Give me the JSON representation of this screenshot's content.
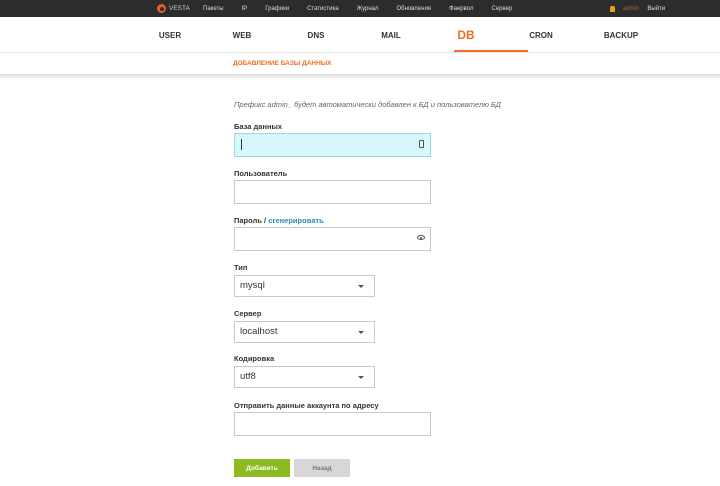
{
  "topbar": {
    "logo": "VESTA",
    "menu": [
      "Пакеты",
      "IP",
      "Графики",
      "Статистика",
      "Журнал",
      "Обновления",
      "Фаервол",
      "Сервер"
    ],
    "user": "admin",
    "logout": "Выйти"
  },
  "nav": {
    "items": [
      "USER",
      "WEB",
      "DNS",
      "MAIL",
      "DB",
      "CRON",
      "BACKUP"
    ],
    "active": "DB"
  },
  "breadcrumb": "ДОБАВЛЕНИЕ БАЗЫ ДАННЫХ",
  "form": {
    "hint": "Префикс admin_ будет автоматически добавлен к БД и пользователю БД",
    "database_label": "База данных",
    "database_value": "",
    "user_label": "Пользователь",
    "user_value": "",
    "password_label": "Пароль /",
    "password_generate": "сгенерировать",
    "password_value": "",
    "type_label": "Тип",
    "type_value": "mysql",
    "server_label": "Сервер",
    "server_value": "localhost",
    "charset_label": "Кодировка",
    "charset_value": "utf8",
    "email_label": "Отправить данные аккаунта по адресу",
    "email_value": ""
  },
  "buttons": {
    "add": "Добавить",
    "back": "Назад"
  },
  "colors": {
    "accent": "#f26d1f",
    "link": "#2b8db3",
    "add_button": "#8cba21",
    "focus_field": "#d6f8fc"
  }
}
